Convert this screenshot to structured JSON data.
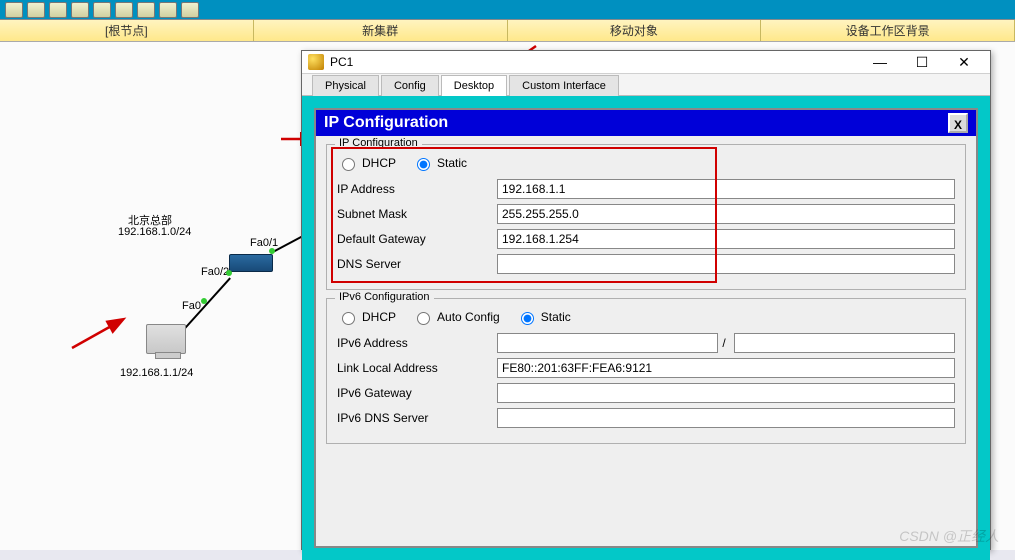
{
  "outer_menu": {
    "items": [
      "[根节点]",
      "新集群",
      "移动对象",
      "设备工作区背景"
    ]
  },
  "topology": {
    "site_label": "北京总部",
    "site_subnet": "192.168.1.0/24",
    "ports": {
      "fa01": "Fa0/1",
      "fa02": "Fa0/2",
      "fa0": "Fa0"
    },
    "pc_label": "192.168.1.1/24"
  },
  "dialog": {
    "window_title": "PC1",
    "tabs": {
      "physical": "Physical",
      "config": "Config",
      "desktop": "Desktop",
      "custom": "Custom Interface"
    },
    "panel_title": "IP Configuration",
    "close_btn": "X",
    "ipv4": {
      "group_label": "IP Configuration",
      "dhcp_label": "DHCP",
      "static_label": "Static",
      "ip_label": "IP Address",
      "ip_value": "192.168.1.1",
      "mask_label": "Subnet Mask",
      "mask_value": "255.255.255.0",
      "gw_label": "Default Gateway",
      "gw_value": "192.168.1.254",
      "dns_label": "DNS Server",
      "dns_value": ""
    },
    "ipv6": {
      "group_label": "IPv6 Configuration",
      "dhcp_label": "DHCP",
      "auto_label": "Auto Config",
      "static_label": "Static",
      "addr_label": "IPv6 Address",
      "addr_value": "",
      "prefix_value": "",
      "ll_label": "Link Local Address",
      "ll_value": "FE80::201:63FF:FEA6:9121",
      "gw_label": "IPv6 Gateway",
      "gw_value": "",
      "dns_label": "IPv6 DNS Server",
      "dns_value": ""
    }
  },
  "watermark": "CSDN @正经人"
}
